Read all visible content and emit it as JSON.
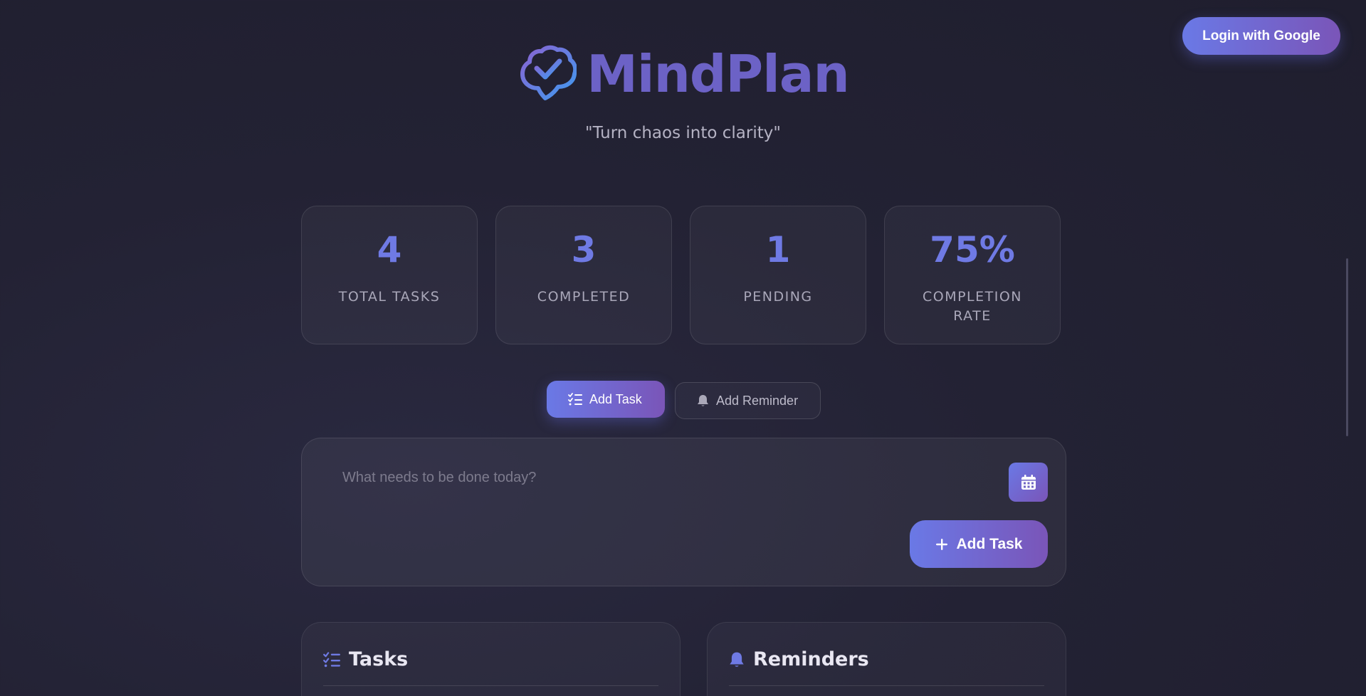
{
  "header": {
    "login_label": "Login with Google",
    "brand_name": "MindPlan",
    "brand_icon": "brain-check-icon",
    "tagline": "\"Turn chaos into clarity\""
  },
  "stats": [
    {
      "value": "4",
      "label": "TOTAL TASKS"
    },
    {
      "value": "3",
      "label": "COMPLETED"
    },
    {
      "value": "1",
      "label": "PENDING"
    },
    {
      "value": "75%",
      "label": "COMPLETION RATE"
    }
  ],
  "tabs": {
    "add_task": {
      "label": "Add Task",
      "icon": "task-list-icon",
      "active": true
    },
    "add_reminder": {
      "label": "Add Reminder",
      "icon": "bell-icon",
      "active": false
    }
  },
  "composer": {
    "placeholder": "What needs to be done today?",
    "value": "",
    "calendar_icon": "calendar-icon",
    "submit_label": "Add Task",
    "submit_icon": "plus-icon"
  },
  "panels": {
    "tasks": {
      "title": "Tasks",
      "icon": "task-list-icon"
    },
    "reminders": {
      "title": "Reminders",
      "icon": "bell-icon"
    }
  },
  "colors": {
    "accent_start": "#6a79e6",
    "accent_end": "#7a55b8",
    "brand_text": "#6c62c6",
    "background": "#232234"
  }
}
